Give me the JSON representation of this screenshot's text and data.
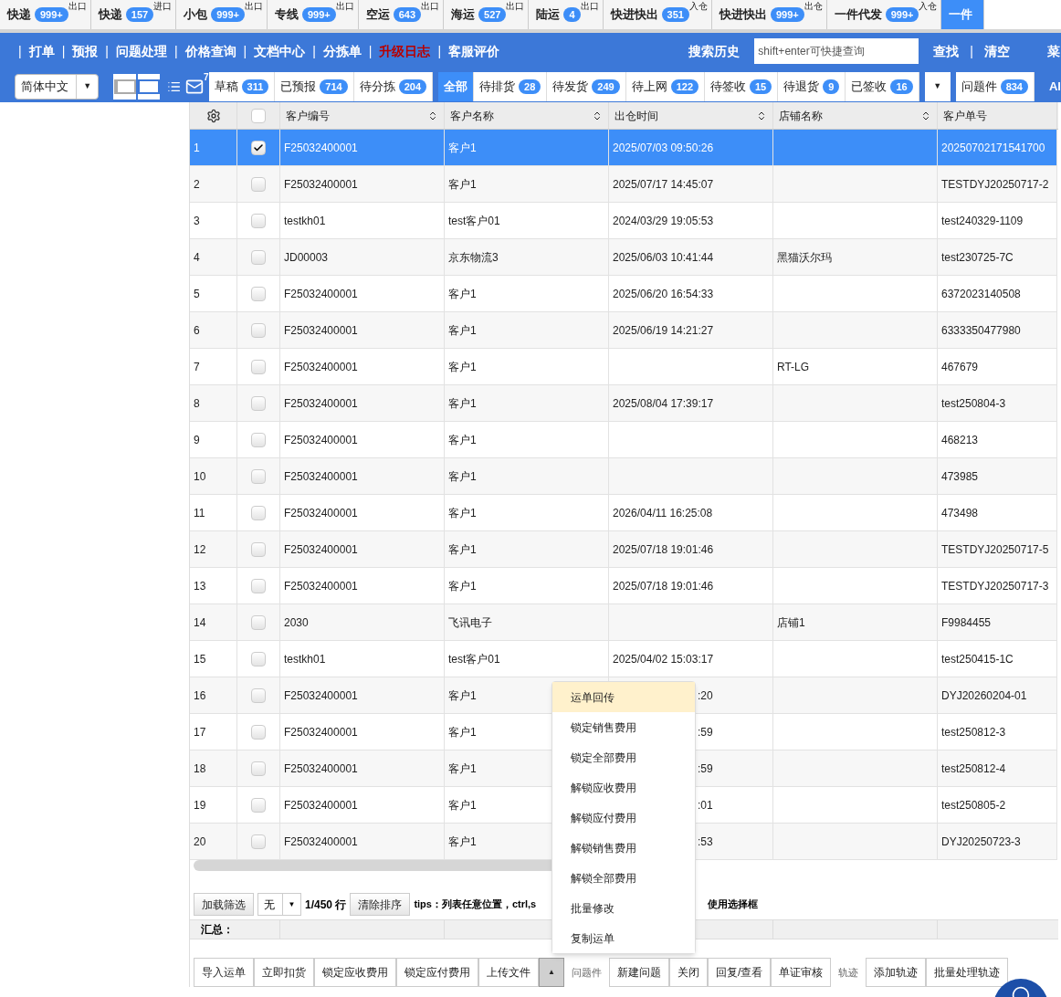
{
  "top_tabs": [
    {
      "label": "快递",
      "count": "999+",
      "tag": "出口",
      "selected": false
    },
    {
      "label": "快递",
      "count": "157",
      "tag": "进口",
      "selected": false
    },
    {
      "label": "小包",
      "count": "999+",
      "tag": "出口",
      "selected": false
    },
    {
      "label": "专线",
      "count": "999+",
      "tag": "出口",
      "selected": false
    },
    {
      "label": "空运",
      "count": "643",
      "tag": "出口",
      "selected": false
    },
    {
      "label": "海运",
      "count": "527",
      "tag": "出口",
      "selected": false
    },
    {
      "label": "陆运",
      "count": "4",
      "tag": "出口",
      "selected": false
    },
    {
      "label": "快进快出",
      "count": "351",
      "tag": "入仓",
      "selected": false
    },
    {
      "label": "快进快出",
      "count": "999+",
      "tag": "出仓",
      "selected": false
    },
    {
      "label": "一件代发",
      "count": "999+",
      "tag": "入仓",
      "selected": false
    },
    {
      "label": "一件",
      "selected": true
    }
  ],
  "nav": {
    "items": [
      {
        "label": "打单",
        "highlight": false
      },
      {
        "label": "预报",
        "highlight": false
      },
      {
        "label": "问题处理",
        "highlight": false
      },
      {
        "label": "价格查询",
        "highlight": false
      },
      {
        "label": "文档中心",
        "highlight": false
      },
      {
        "label": "分拣单",
        "highlight": false
      },
      {
        "label": "升级日志",
        "highlight": true
      },
      {
        "label": "客服评价",
        "highlight": false
      }
    ],
    "separator": "|",
    "history": "搜索历史",
    "search": {
      "placeholder": "shift+enter可快捷查询"
    },
    "find": "查找",
    "clear": "清空",
    "menu": "菜"
  },
  "toolbar": {
    "language": "简体中文",
    "language_caret": "▼",
    "more_caret": "▼",
    "mail_badge": "7",
    "groups": [
      {
        "kind": "group",
        "items": [
          {
            "label": "草稿",
            "count": "311",
            "selected": false
          },
          {
            "label": "已预报",
            "count": "714",
            "selected": false
          },
          {
            "label": "待分拣",
            "count": "204",
            "selected": false
          }
        ]
      },
      {
        "kind": "group",
        "items": [
          {
            "label": "全部",
            "selected": true
          },
          {
            "label": "待排货",
            "count": "28",
            "selected": false
          },
          {
            "label": "待发货",
            "count": "249",
            "selected": false
          },
          {
            "label": "待上网",
            "count": "122",
            "selected": false
          },
          {
            "label": "待签收",
            "count": "15",
            "selected": false
          },
          {
            "label": "待退货",
            "count": "9",
            "selected": false
          },
          {
            "label": "已签收",
            "count": "16",
            "selected": false
          }
        ]
      },
      {
        "kind": "caret"
      },
      {
        "kind": "group",
        "items": [
          {
            "label": "问题件",
            "count": "834",
            "selected": false
          }
        ]
      }
    ],
    "cut_label": "Al"
  },
  "table": {
    "select_all": {
      "checked": false
    },
    "columns": [
      "客户编号",
      "客户名称",
      "出仓时间",
      "店铺名称",
      "客户单号"
    ],
    "rows": [
      {
        "no": "1",
        "checked": true,
        "selected": true,
        "code": "F25032400001",
        "name": "客户1",
        "time": "2025/07/03 09:50:26",
        "order": "20250702171541700"
      },
      {
        "no": "2",
        "checked": false,
        "selected": false,
        "code": "F25032400001",
        "name": "客户1",
        "time": "2025/07/17 14:45:07",
        "order": "TESTDYJ20250717-2"
      },
      {
        "no": "3",
        "checked": false,
        "selected": false,
        "code": "testkh01",
        "name": "test客户01",
        "time": "2024/03/29 19:05:53",
        "order": "test240329-1109"
      },
      {
        "no": "4",
        "checked": false,
        "selected": false,
        "code": "JD00003",
        "name": "京东物流3",
        "time": "2025/06/03 10:41:44",
        "shop": "黑猫沃尔玛",
        "order": "test230725-7C"
      },
      {
        "no": "5",
        "checked": false,
        "selected": false,
        "code": "F25032400001",
        "name": "客户1",
        "time": "2025/06/20 16:54:33",
        "order": "6372023140508"
      },
      {
        "no": "6",
        "checked": false,
        "selected": false,
        "code": "F25032400001",
        "name": "客户1",
        "time": "2025/06/19 14:21:27",
        "order": "6333350477980"
      },
      {
        "no": "7",
        "checked": false,
        "selected": false,
        "code": "F25032400001",
        "name": "客户1",
        "shop": "RT-LG",
        "order": "467679"
      },
      {
        "no": "8",
        "checked": false,
        "selected": false,
        "code": "F25032400001",
        "name": "客户1",
        "time": "2025/08/04 17:39:17",
        "order": "test250804-3"
      },
      {
        "no": "9",
        "checked": false,
        "selected": false,
        "code": "F25032400001",
        "name": "客户1",
        "order": "468213"
      },
      {
        "no": "10",
        "checked": false,
        "selected": false,
        "code": "F25032400001",
        "name": "客户1",
        "order": "473985"
      },
      {
        "no": "11",
        "checked": false,
        "selected": false,
        "code": "F25032400001",
        "name": "客户1",
        "time": "2026/04/11 16:25:08",
        "order": "473498"
      },
      {
        "no": "12",
        "checked": false,
        "selected": false,
        "code": "F25032400001",
        "name": "客户1",
        "time": "2025/07/18 19:01:46",
        "order": "TESTDYJ20250717-5"
      },
      {
        "no": "13",
        "checked": false,
        "selected": false,
        "code": "F25032400001",
        "name": "客户1",
        "time": "2025/07/18 19:01:46",
        "order": "TESTDYJ20250717-3"
      },
      {
        "no": "14",
        "checked": false,
        "selected": false,
        "code": "2030",
        "name": "飞讯电子",
        "shop": "店铺1",
        "order": "F9984455"
      },
      {
        "no": "15",
        "checked": false,
        "selected": false,
        "code": "testkh01",
        "name": "test客户01",
        "time": "2025/04/02 15:03:17",
        "order": "test250415-1C"
      },
      {
        "no": "16",
        "checked": false,
        "selected": false,
        "code": "F25032400001",
        "name": "客户1",
        "time_tail": ":20",
        "order": "DYJ20260204-01"
      },
      {
        "no": "17",
        "checked": false,
        "selected": false,
        "code": "F25032400001",
        "name": "客户1",
        "time_tail": ":59",
        "order": "test250812-3"
      },
      {
        "no": "18",
        "checked": false,
        "selected": false,
        "code": "F25032400001",
        "name": "客户1",
        "time_tail": ":59",
        "order": "test250812-4"
      },
      {
        "no": "19",
        "checked": false,
        "selected": false,
        "code": "F25032400001",
        "name": "客户1",
        "time_tail": ":01",
        "order": "test250805-2"
      },
      {
        "no": "20",
        "checked": false,
        "selected": false,
        "code": "F25032400001",
        "name": "客户1",
        "time_tail": ":53",
        "order": "DYJ20250723-3"
      }
    ]
  },
  "footer": {
    "load_filter": "加载筛选",
    "filter_value": "无",
    "filter_caret": "▼",
    "rows_info": "1/450 行",
    "clear_sort": "清除排序",
    "tips_start": "tips：列表任意位置，ctrl,s",
    "tips_end": "使用选择框",
    "total_label": "汇总："
  },
  "context_menu": [
    {
      "label": "运单回传",
      "highlighted": true
    },
    {
      "label": "锁定销售费用",
      "highlighted": false
    },
    {
      "label": "锁定全部费用",
      "highlighted": false
    },
    {
      "label": "解锁应收费用",
      "highlighted": false
    },
    {
      "label": "解锁应付费用",
      "highlighted": false
    },
    {
      "label": "解锁销售费用",
      "highlighted": false
    },
    {
      "label": "解锁全部费用",
      "highlighted": false
    },
    {
      "label": "批量修改",
      "highlighted": false
    },
    {
      "label": "复制运单",
      "highlighted": false
    }
  ],
  "action_bar": [
    {
      "kind": "button",
      "label": "导入运单"
    },
    {
      "kind": "button",
      "label": "立即扣货"
    },
    {
      "kind": "button",
      "label": "锁定应收费用"
    },
    {
      "kind": "button",
      "label": "锁定应付费用"
    },
    {
      "kind": "button",
      "label": "上传文件"
    },
    {
      "kind": "toggle",
      "pressed": true,
      "icon": "▲"
    },
    {
      "kind": "label",
      "label": "问题件"
    },
    {
      "kind": "button",
      "label": "新建问题"
    },
    {
      "kind": "button",
      "label": "关闭"
    },
    {
      "kind": "button",
      "label": "回复/查看"
    },
    {
      "kind": "button",
      "label": "单证审核"
    },
    {
      "kind": "label",
      "label": "轨迹"
    },
    {
      "kind": "button",
      "label": "添加轨迹"
    },
    {
      "kind": "button",
      "label": "批量处理轨迹"
    }
  ]
}
